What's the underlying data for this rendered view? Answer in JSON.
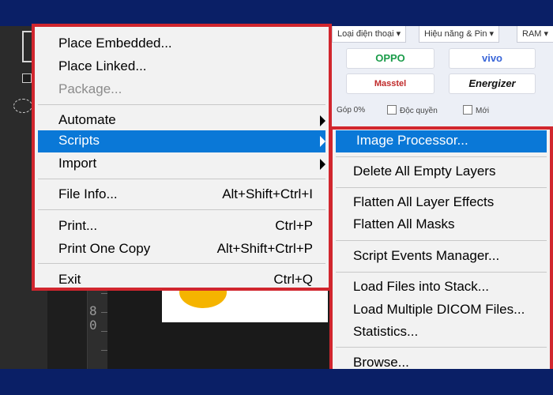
{
  "colors": {
    "frame": "#0a1f66",
    "highlight": "#0a78d7",
    "menu_border": "#d1262e",
    "menu_bg": "#f2f2f2"
  },
  "web_backdrop": {
    "dropdowns": [
      "Loại điện thoại ▾",
      "Hiệu năng & Pin ▾",
      "RAM ▾"
    ],
    "brands": [
      "OPPO",
      "vivo",
      "Masstel",
      "Energizer"
    ],
    "filters": [
      "Góp 0%",
      "Độc quyền",
      "Mới"
    ]
  },
  "ruler": {
    "digits": [
      "8",
      "0"
    ]
  },
  "main_menu": {
    "groups": [
      [
        {
          "label": "Place Embedded...",
          "shortcut": "",
          "disabled": false
        },
        {
          "label": "Place Linked...",
          "shortcut": "",
          "disabled": false
        },
        {
          "label": "Package...",
          "shortcut": "",
          "disabled": true
        }
      ],
      [
        {
          "label": "Automate",
          "shortcut": "",
          "submenu": true
        },
        {
          "label": "Scripts",
          "shortcut": "",
          "submenu": true,
          "highlighted": true
        },
        {
          "label": "Import",
          "shortcut": "",
          "submenu": true
        }
      ],
      [
        {
          "label": "File Info...",
          "shortcut": "Alt+Shift+Ctrl+I"
        }
      ],
      [
        {
          "label": "Print...",
          "shortcut": "Ctrl+P"
        },
        {
          "label": "Print One Copy",
          "shortcut": "Alt+Shift+Ctrl+P"
        }
      ],
      [
        {
          "label": "Exit",
          "shortcut": "Ctrl+Q"
        }
      ]
    ]
  },
  "scripts_submenu": {
    "groups": [
      [
        {
          "label": "Image Processor...",
          "highlighted": true
        }
      ],
      [
        {
          "label": "Delete All Empty Layers"
        }
      ],
      [
        {
          "label": "Flatten All Layer Effects"
        },
        {
          "label": "Flatten All Masks"
        }
      ],
      [
        {
          "label": "Script Events Manager..."
        }
      ],
      [
        {
          "label": "Load Files into Stack..."
        },
        {
          "label": "Load Multiple DICOM Files..."
        },
        {
          "label": "Statistics..."
        }
      ],
      [
        {
          "label": "Browse..."
        }
      ]
    ]
  }
}
